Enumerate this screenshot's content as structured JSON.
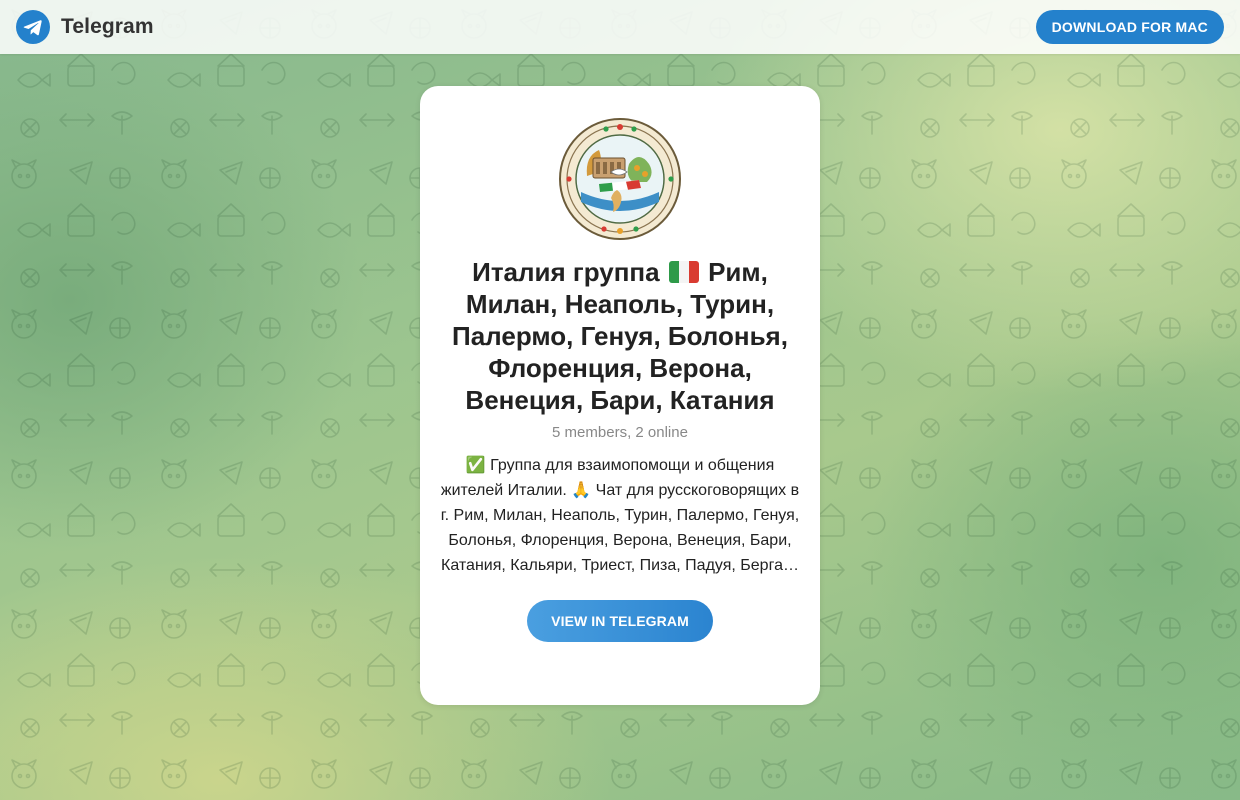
{
  "header": {
    "app_name": "Telegram",
    "download_label": "DOWNLOAD FOR MAC",
    "brand_color": "#2481cc"
  },
  "channel": {
    "title_before_flag": "Италия группа",
    "flag_emoji": "🇮🇹",
    "title_after_flag": "Рим, Милан, Неаполь, Турин, Палермо, Генуя, Болонья, Флоренция, Верона, Венеция, Бари, Катания",
    "members": "5 members, 2 online",
    "description": "✅ Группа для взаимопомощи и общения жителей Италии. 🙏 Чат для русскоговорящих в г. Рим, Милан, Неаполь, Турин, Палермо, Генуя, Болонья, Флоренция, Верона, Венеция, Бари, Катания, Кальяри, Триест, Пиза, Падуя, Берга…",
    "view_label": "VIEW IN TELEGRAM"
  },
  "icons": {
    "brand": "telegram-plane-icon",
    "avatar": "italy-group-emblem"
  }
}
